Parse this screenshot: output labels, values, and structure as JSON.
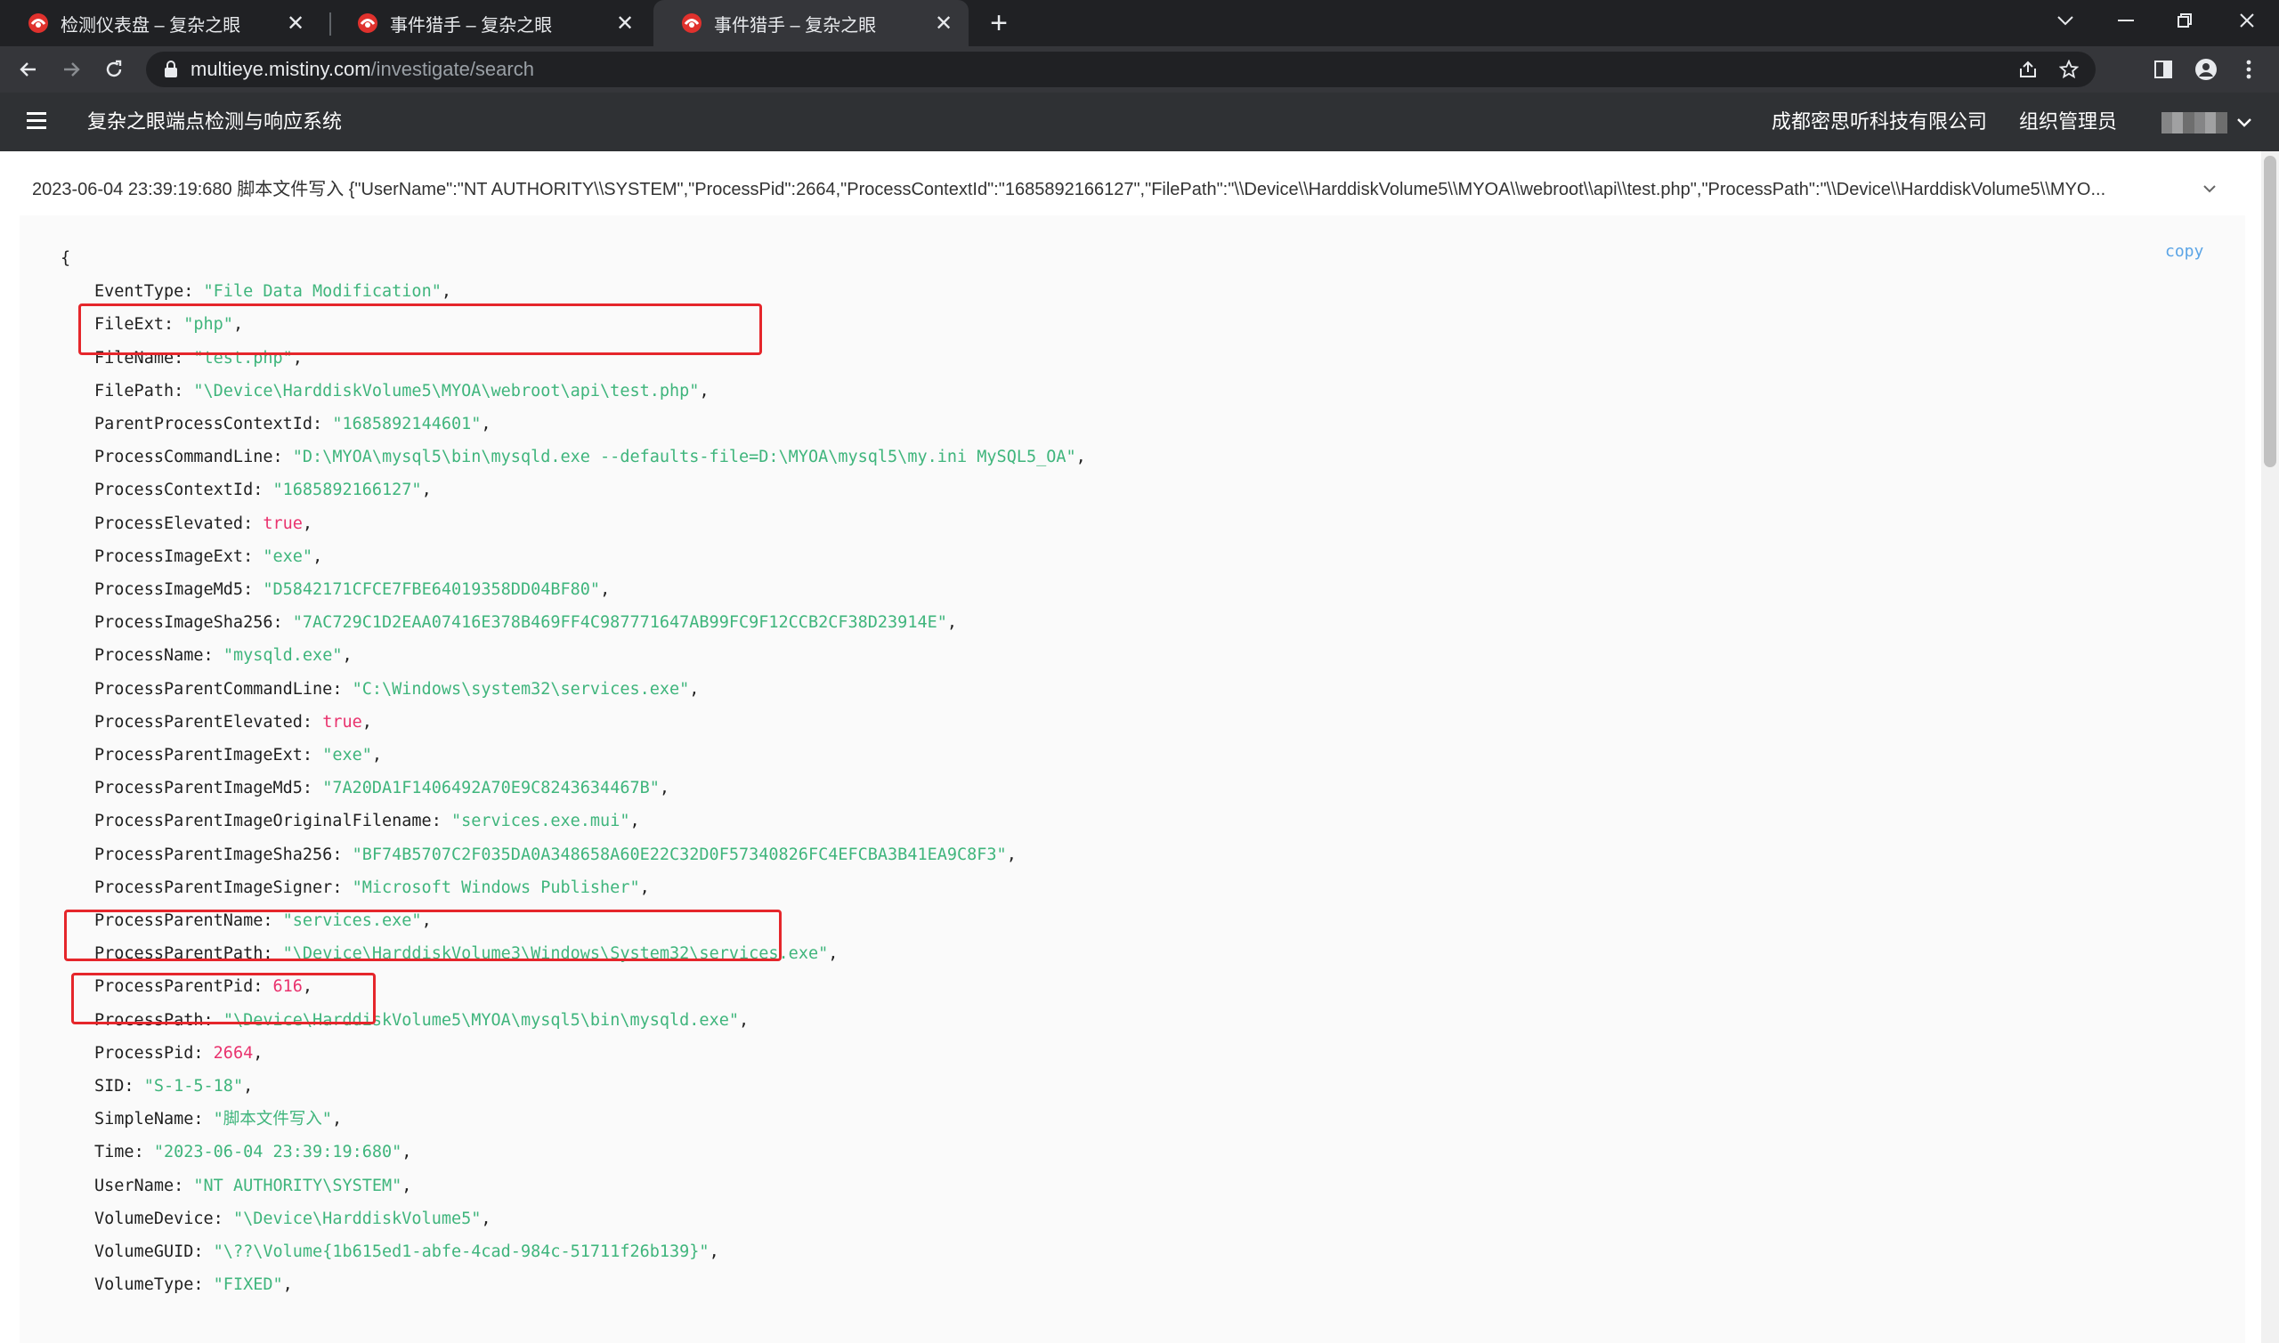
{
  "browser": {
    "tabs": [
      {
        "title": "检测仪表盘 – 复杂之眼",
        "active": false
      },
      {
        "title": "事件猎手 – 复杂之眼",
        "active": false
      },
      {
        "title": "事件猎手 – 复杂之眼",
        "active": true
      }
    ],
    "url_host": "multieye.mistiny.com",
    "url_path": "/investigate/search",
    "accent_favicon": "#e0312d"
  },
  "header": {
    "app_title": "复杂之眼端点检测与响应系统",
    "company": "成都密思听科技有限公司",
    "role": "组织管理员"
  },
  "event": {
    "summary": "2023-06-04 23:39:19:680 脚本文件写入 {\"UserName\":\"NT AUTHORITY\\\\SYSTEM\",\"ProcessPid\":2664,\"ProcessContextId\":\"1685892166127\",\"FilePath\":\"\\\\Device\\\\HarddiskVolume5\\\\MYOA\\\\webroot\\\\api\\\\test.php\",\"ProcessPath\":\"\\\\Device\\\\HarddiskVolume5\\\\MYO...",
    "copy_label": "copy",
    "open_brace": "{",
    "fields": [
      {
        "key": "EventType",
        "value": "\"File Data Modification\"",
        "type": "str"
      },
      {
        "key": "FileExt",
        "value": "\"php\"",
        "type": "str"
      },
      {
        "key": "FileName",
        "value": "\"test.php\"",
        "type": "str"
      },
      {
        "key": "FilePath",
        "value": "\"\\Device\\HarddiskVolume5\\MYOA\\webroot\\api\\test.php\"",
        "type": "str"
      },
      {
        "key": "ParentProcessContextId",
        "value": "\"1685892144601\"",
        "type": "str"
      },
      {
        "key": "ProcessCommandLine",
        "value": "\"D:\\MYOA\\mysql5\\bin\\mysqld.exe --defaults-file=D:\\MYOA\\mysql5\\my.ini MySQL5_OA\"",
        "type": "str"
      },
      {
        "key": "ProcessContextId",
        "value": "\"1685892166127\"",
        "type": "str"
      },
      {
        "key": "ProcessElevated",
        "value": "true",
        "type": "bool"
      },
      {
        "key": "ProcessImageExt",
        "value": "\"exe\"",
        "type": "str"
      },
      {
        "key": "ProcessImageMd5",
        "value": "\"D5842171CFCE7FBE64019358DD04BF80\"",
        "type": "str"
      },
      {
        "key": "ProcessImageSha256",
        "value": "\"7AC729C1D2EAA07416E378B469FF4C987771647AB99FC9F12CCB2CF38D23914E\"",
        "type": "str"
      },
      {
        "key": "ProcessName",
        "value": "\"mysqld.exe\"",
        "type": "str"
      },
      {
        "key": "ProcessParentCommandLine",
        "value": "\"C:\\Windows\\system32\\services.exe\"",
        "type": "str"
      },
      {
        "key": "ProcessParentElevated",
        "value": "true",
        "type": "bool"
      },
      {
        "key": "ProcessParentImageExt",
        "value": "\"exe\"",
        "type": "str"
      },
      {
        "key": "ProcessParentImageMd5",
        "value": "\"7A20DA1F1406492A70E9C8243634467B\"",
        "type": "str"
      },
      {
        "key": "ProcessParentImageOriginalFilename",
        "value": "\"services.exe.mui\"",
        "type": "str"
      },
      {
        "key": "ProcessParentImageSha256",
        "value": "\"BF74B5707C2F035DA0A348658A60E22C32D0F57340826FC4EFCBA3B41EA9C8F3\"",
        "type": "str"
      },
      {
        "key": "ProcessParentImageSigner",
        "value": "\"Microsoft Windows Publisher\"",
        "type": "str"
      },
      {
        "key": "ProcessParentName",
        "value": "\"services.exe\"",
        "type": "str"
      },
      {
        "key": "ProcessParentPath",
        "value": "\"\\Device\\HarddiskVolume3\\Windows\\System32\\services.exe\"",
        "type": "str"
      },
      {
        "key": "ProcessParentPid",
        "value": "616",
        "type": "num"
      },
      {
        "key": "ProcessPath",
        "value": "\"\\Device\\HarddiskVolume5\\MYOA\\mysql5\\bin\\mysqld.exe\"",
        "type": "str"
      },
      {
        "key": "ProcessPid",
        "value": "2664",
        "type": "num"
      },
      {
        "key": "SID",
        "value": "\"S-1-5-18\"",
        "type": "str"
      },
      {
        "key": "SimpleName",
        "value": "\"脚本文件写入\"",
        "type": "str"
      },
      {
        "key": "Time",
        "value": "\"2023-06-04 23:39:19:680\"",
        "type": "str"
      },
      {
        "key": "UserName",
        "value": "\"NT AUTHORITY\\SYSTEM\"",
        "type": "str"
      },
      {
        "key": "VolumeDevice",
        "value": "\"\\Device\\HarddiskVolume5\"",
        "type": "str"
      },
      {
        "key": "VolumeGUID",
        "value": "\"\\??\\Volume{1b615ed1-abfe-4cad-984c-51711f26b139}\"",
        "type": "str"
      },
      {
        "key": "VolumeType",
        "value": "\"FIXED\"",
        "type": "str"
      }
    ],
    "highlighted_keys": [
      "FilePath",
      "ProcessPath",
      "SimpleName"
    ],
    "highlight_color": "#e5262b"
  }
}
